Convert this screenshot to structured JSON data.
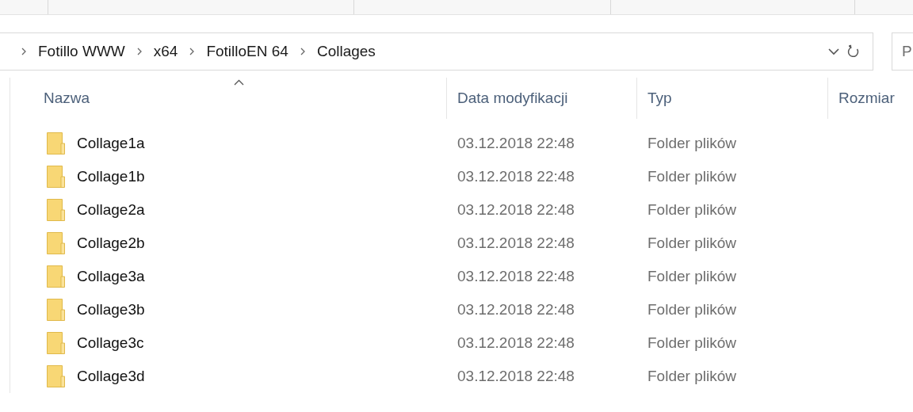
{
  "address_bar": {
    "path": [
      "Fotillo WWW",
      "x64",
      "FotilloEN 64",
      "Collages"
    ]
  },
  "search": {
    "placeholder": "P"
  },
  "table": {
    "columns": [
      "Nazwa",
      "Data modyfikacji",
      "Typ",
      "Rozmiar"
    ],
    "rows": [
      {
        "name": "Collage1a",
        "modified": "03.12.2018 22:48",
        "type": "Folder plików"
      },
      {
        "name": "Collage1b",
        "modified": "03.12.2018 22:48",
        "type": "Folder plików"
      },
      {
        "name": "Collage2a",
        "modified": "03.12.2018 22:48",
        "type": "Folder plików"
      },
      {
        "name": "Collage2b",
        "modified": "03.12.2018 22:48",
        "type": "Folder plików"
      },
      {
        "name": "Collage3a",
        "modified": "03.12.2018 22:48",
        "type": "Folder plików"
      },
      {
        "name": "Collage3b",
        "modified": "03.12.2018 22:48",
        "type": "Folder plików"
      },
      {
        "name": "Collage3c",
        "modified": "03.12.2018 22:48",
        "type": "Folder plików"
      },
      {
        "name": "Collage3d",
        "modified": "03.12.2018 22:48",
        "type": "Folder plików"
      }
    ]
  }
}
